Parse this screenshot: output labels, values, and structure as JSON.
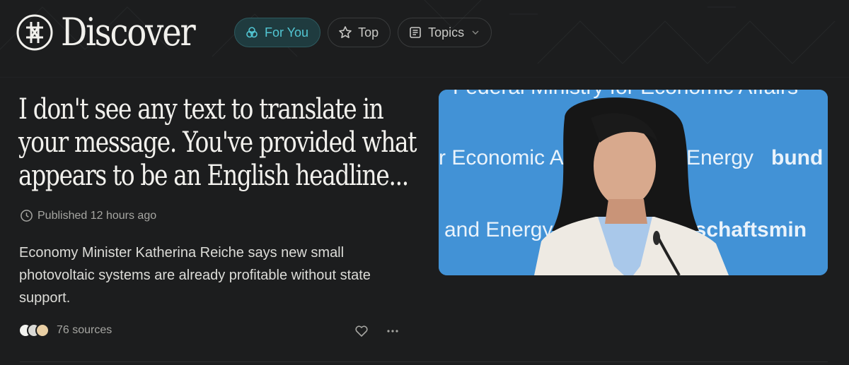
{
  "header": {
    "logo_text": "Discover",
    "nav": [
      {
        "label": "For You",
        "icon": "for-you-icon",
        "active": true
      },
      {
        "label": "Top",
        "icon": "star-icon",
        "active": false
      },
      {
        "label": "Topics",
        "icon": "topics-icon",
        "active": false
      }
    ]
  },
  "article": {
    "headline": "I don't see any text to translate in your message. You've provided what appears to be an English headline...",
    "published": "Published 12 hours ago",
    "summary": "Economy Minister Katherina Reiche says new small photovoltaic systems are already profitable without state support.",
    "sources_count": "76 sources",
    "image": {
      "backdrop_text": {
        "line1": "Federal Ministry for Economic Affairs",
        "line2_left": "r Economic Af",
        "line2_mid": "Energy",
        "line2_right": "bund",
        "line3_left": "and Energy",
        "line3_right": "rtschaftsmin"
      }
    }
  },
  "colors": {
    "background": "#1c1d1e",
    "accent": "#52c6d3",
    "accent_bg": "#1f3b3f",
    "backdrop_blue": "#3f8fd3"
  }
}
